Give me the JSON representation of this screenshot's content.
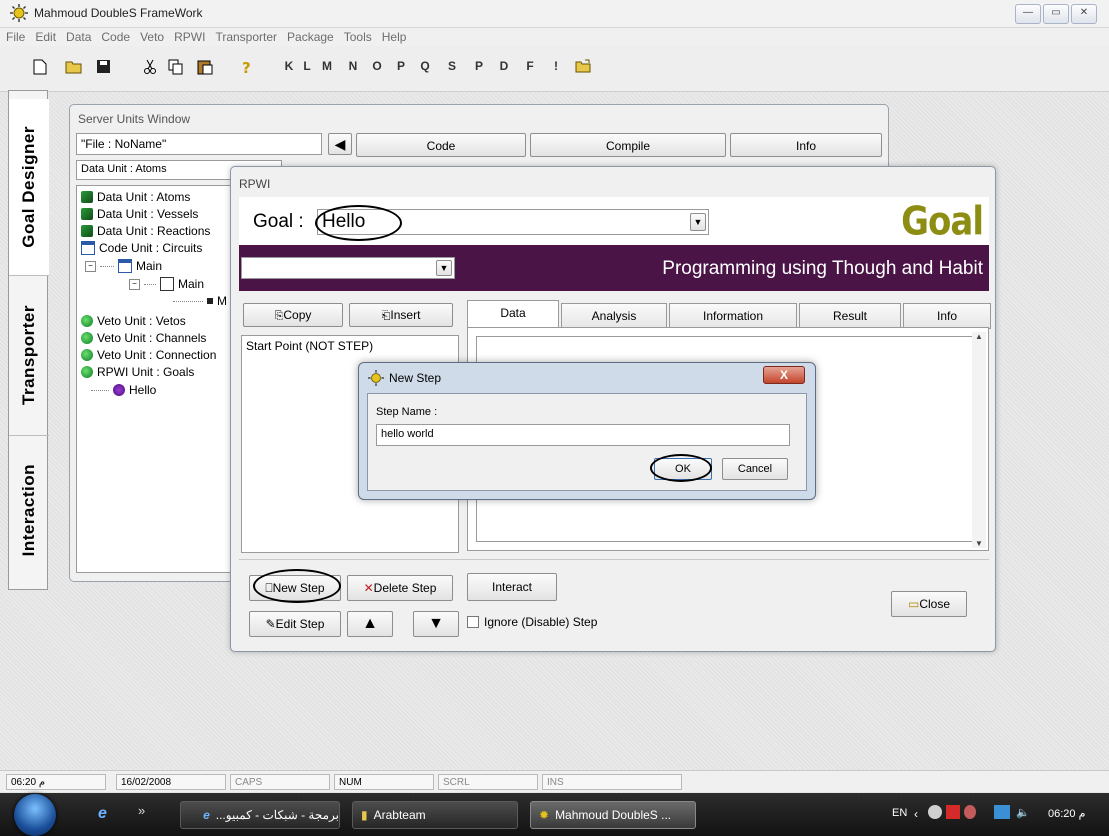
{
  "app": {
    "title": "Mahmoud DoubleS FrameWork",
    "window_controls": [
      "—",
      "▭",
      "✕"
    ]
  },
  "menu": [
    "File",
    "Edit",
    "Data",
    "Code",
    "Veto",
    "RPWI",
    "Transporter",
    "Package",
    "Tools",
    "Help"
  ],
  "toolbar": {
    "letters": [
      "K",
      "L",
      "M",
      "N",
      "O",
      "P",
      "Q",
      "S",
      "P",
      "D",
      "F",
      "!"
    ]
  },
  "side_tabs": [
    "Goal Designer",
    "Transporter",
    "Interaction"
  ],
  "server_window": {
    "caption": "Server Units Window",
    "file_field": "\"File : NoName\"",
    "unit_field": "Data Unit : Atoms",
    "buttons": [
      "Code",
      "Compile",
      "Info"
    ],
    "tree": [
      "Data Unit : Atoms",
      "Data Unit : Vessels",
      "Data Unit : Reactions",
      "Code Unit : Circuits",
      "Main",
      "Main",
      "M",
      "Veto Unit : Vetos",
      "Veto Unit : Channels",
      "Veto Unit : Connection",
      "RPWI Unit : Goals",
      "Hello"
    ]
  },
  "rpwi": {
    "caption": "RPWI",
    "goal_label": "Goal :",
    "goal_value": "Hello",
    "brand_title": "Goal Designer",
    "tagline": "Programming using Though and Habit",
    "copy_label": "Copy",
    "insert_label": "Insert",
    "steps": [
      "Start Point (NOT STEP)"
    ],
    "tabs": [
      "Data",
      "Analysis",
      "Information",
      "Result",
      "Info"
    ],
    "new_step": "New Step",
    "delete_step": "Delete Step",
    "interact": "Interact",
    "edit_step": "Edit Step",
    "ignore_step": "Ignore (Disable) Step",
    "close": "Close",
    "up_arrow": "▲",
    "down_arrow": "▼"
  },
  "dialog": {
    "title": "New Step",
    "close_glyph": "X",
    "step_name_label": "Step Name :",
    "step_name_value": "hello world",
    "ok": "OK",
    "cancel": "Cancel"
  },
  "status_bar": {
    "time": "06:20 م",
    "date": "16/02/2008",
    "caps": "CAPS",
    "num": "NUM",
    "scrl": "SCRL",
    "ins": "INS"
  },
  "taskbar": {
    "chevron": "»",
    "tasks": [
      "برمجة - شبكات - كمبيو...",
      "Arabteam",
      "Mahmoud DoubleS ..."
    ],
    "lang": "EN",
    "clock": "06:20 م"
  }
}
